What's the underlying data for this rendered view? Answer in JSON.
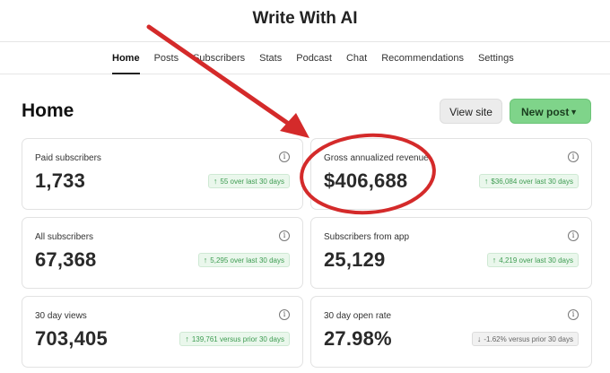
{
  "header": {
    "site_title": "Write With AI"
  },
  "nav": {
    "items": [
      {
        "label": "Home",
        "active": true
      },
      {
        "label": "Posts"
      },
      {
        "label": "Subscribers"
      },
      {
        "label": "Stats"
      },
      {
        "label": "Podcast"
      },
      {
        "label": "Chat"
      },
      {
        "label": "Recommendations"
      },
      {
        "label": "Settings"
      }
    ]
  },
  "main": {
    "title": "Home",
    "view_site_label": "View site",
    "new_post_label": "New post",
    "new_post_caret": "▼"
  },
  "cards": [
    {
      "label": "Paid subscribers",
      "value": "1,733",
      "badge": "55 over last 30 days",
      "trend": "up"
    },
    {
      "label": "Gross annualized revenue",
      "value": "$406,688",
      "badge": "$36,084 over last 30 days",
      "trend": "up"
    },
    {
      "label": "All subscribers",
      "value": "67,368",
      "badge": "5,295 over last 30 days",
      "trend": "up"
    },
    {
      "label": "Subscribers from app",
      "value": "25,129",
      "badge": "4,219 over last 30 days",
      "trend": "up"
    },
    {
      "label": "30 day views",
      "value": "703,405",
      "badge": "139,761 versus prior 30 days",
      "trend": "up"
    },
    {
      "label": "30 day open rate",
      "value": "27.98%",
      "badge": "-1.62% versus prior 30 days",
      "trend": "down"
    }
  ],
  "icons": {
    "info": "info-icon",
    "arrow_up": "↑",
    "arrow_down": "↓"
  },
  "colors": {
    "accent_green": "#7fd48a",
    "annotation_red": "#d42a2a",
    "trend_up": "#3e9c52"
  }
}
